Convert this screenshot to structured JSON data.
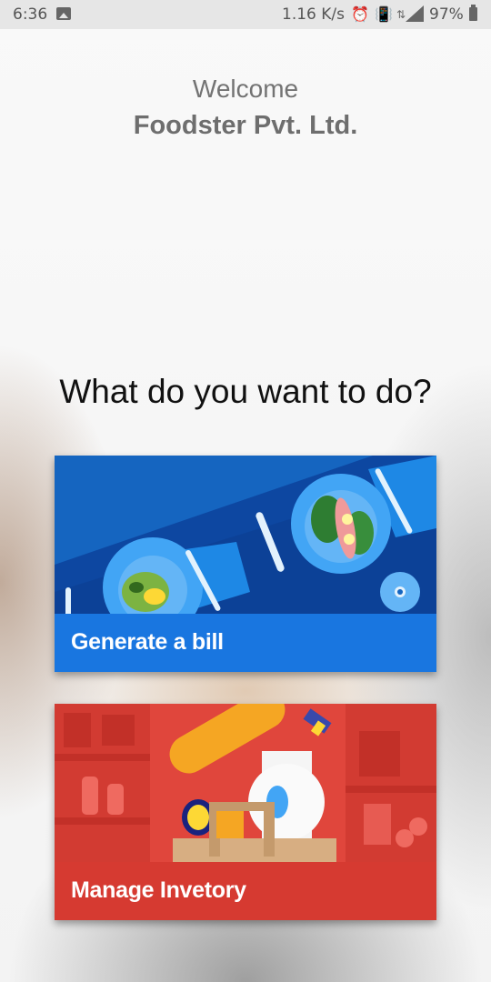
{
  "status_bar": {
    "time": "6:36",
    "net_speed": "1.16 K/s",
    "battery": "97%",
    "icons": [
      "image-icon",
      "alarm-icon",
      "vibrate-icon",
      "data-arrows-icon",
      "signal-4g-icon",
      "battery-icon"
    ]
  },
  "header": {
    "welcome": "Welcome",
    "company": "Foodster Pvt. Ltd."
  },
  "prompt": "What do you want to do?",
  "actions": [
    {
      "label": "Generate a bill",
      "color": "#1976e0"
    },
    {
      "label": "Manage Invetory",
      "color": "#d63a31"
    }
  ]
}
